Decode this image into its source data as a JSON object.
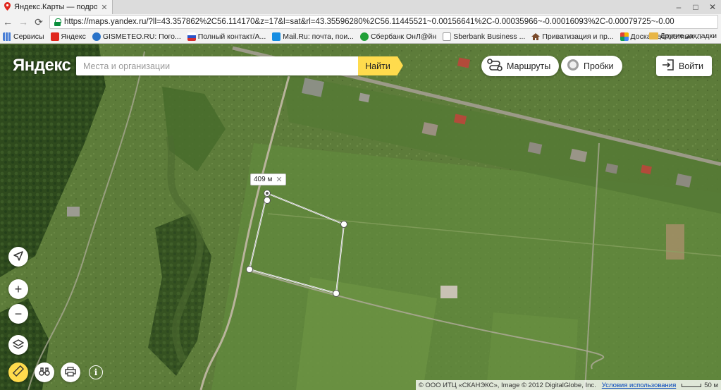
{
  "browser": {
    "tab_title": "Яндекс.Карты — подробная карта",
    "url": "https://maps.yandex.ru/?ll=43.357862%2C56.114170&z=17&l=sat&rl=43.35596280%2C56.11445521~0.00156641%2C-0.00035966~-0.00016093%2C-0.00079725~-0.00",
    "bookmarks": [
      {
        "label": "Сервисы",
        "color": "#4a7fd6"
      },
      {
        "label": "Яндекс",
        "color": "#e0261c"
      },
      {
        "label": "GISMETEO.RU: Пого...",
        "color": "#2a73c9"
      },
      {
        "label": "Полный контакт/А...",
        "color": "#d32f2f"
      },
      {
        "label": "Mail.Ru: почта, пои...",
        "color": "#168de2"
      },
      {
        "label": "Сбербанк ОнЛ@йн",
        "color": "#21a038"
      },
      {
        "label": "Sberbank Business ...",
        "color": "#bdbdbd"
      },
      {
        "label": "Приватизация и пр...",
        "color": "#7a4a2a"
      },
      {
        "label": "Доска бесплатных ...",
        "color": "#6a4fc4"
      }
    ],
    "other_bookmarks": "Другие закладки"
  },
  "map": {
    "logo": "Яндекс",
    "search": {
      "placeholder": "Места и организации",
      "button": "Найти"
    },
    "routes_label": "Маршруты",
    "traffic_label": "Пробки",
    "login_label": "Войти",
    "measure_label": "409 м",
    "copyright": "© ООО ИТЦ «СКАНЭКС», Image © 2012 DigitalGlobe, Inc.",
    "terms_link": "Условия использования",
    "scale_label": "50 м",
    "colors": {
      "accent": "#ffdb4d",
      "grass": "#5f7e3c",
      "forest": "#2f4a1e"
    }
  }
}
